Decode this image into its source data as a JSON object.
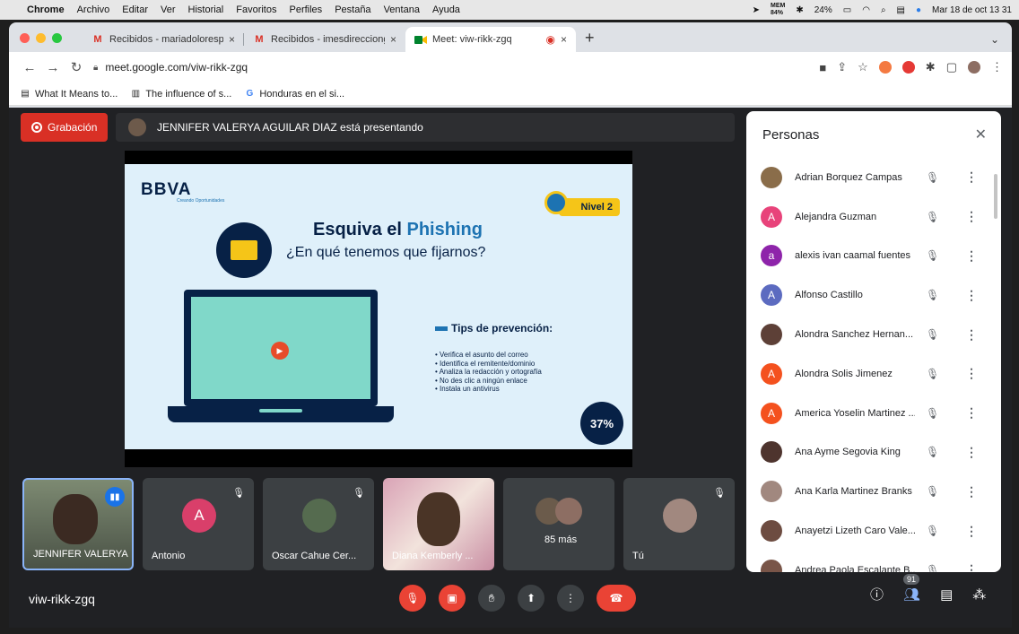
{
  "macos_menubar": {
    "app_name": "Chrome",
    "menus": [
      "Archivo",
      "Editar",
      "Ver",
      "Historial",
      "Favoritos",
      "Perfiles",
      "Pestaña",
      "Ventana",
      "Ayuda"
    ],
    "mem_label": "MEM",
    "mem_value": "84%",
    "battery": "24%",
    "datetime": "Mar 18 de oct 13 31"
  },
  "browser": {
    "tabs": [
      {
        "label": "Recibidos - mariadolorespanto",
        "favicon": "gmail-icon"
      },
      {
        "label": "Recibidos - imesdirecciongene",
        "favicon": "gmail-icon"
      },
      {
        "label": "Meet: viw-rikk-zgq",
        "favicon": "meet-icon",
        "active": true
      }
    ],
    "url": "meet.google.com/viw-rikk-zgq",
    "bookmarks": [
      "What It Means to...",
      "The influence of s...",
      "Honduras en el si..."
    ]
  },
  "meet": {
    "recording_label": "Grabación",
    "presenting_text": "JENNIFER VALERYA AGUILAR DIAZ está presentando",
    "meeting_code": "viw-rikk-zgq",
    "people_count": "91",
    "slide": {
      "brand": "BBVA",
      "tagline": "Creando Oportunidades",
      "level": "Nivel 2",
      "title_part1": "Esquiva el ",
      "title_part2": "Phishing",
      "subtitle": "¿En qué tenemos que fijarnos?",
      "tips_title": "Tips de prevención:",
      "tips": [
        "Verifica el asunto del correo",
        "Identifica el remitente/dominio",
        "Analiza la redacción y ortografía",
        "No des clic a ningún enlace",
        "Instala un antivirus"
      ],
      "progress": "37%"
    },
    "tiles": [
      {
        "name": "JENNIFER VALERYA",
        "speaking": true
      },
      {
        "name": "Antonio",
        "initial": "A",
        "color": "#d93f6a"
      },
      {
        "name": "Oscar Cahue Cer..."
      },
      {
        "name": "Diana Kemberly ..."
      },
      {
        "name": "85 más"
      },
      {
        "name": "Tú"
      }
    ],
    "panel": {
      "title": "Personas",
      "people": [
        {
          "name": "Adrian Borquez Campas",
          "initial": "",
          "color": "#8a6d4a"
        },
        {
          "name": "Alejandra Guzman",
          "initial": "A",
          "color": "#e8437a"
        },
        {
          "name": "alexis ivan caamal fuentes",
          "initial": "a",
          "color": "#8e24aa"
        },
        {
          "name": "Alfonso Castillo",
          "initial": "A",
          "color": "#5c6bc0"
        },
        {
          "name": "Alondra Sanchez Hernan...",
          "initial": "",
          "color": "#5d4037"
        },
        {
          "name": "Alondra Solis Jimenez",
          "initial": "A",
          "color": "#f4511e"
        },
        {
          "name": "America Yoselin Martinez ...",
          "initial": "A",
          "color": "#f4511e"
        },
        {
          "name": "Ana Ayme Segovia King",
          "initial": "",
          "color": "#4e342e"
        },
        {
          "name": "Ana Karla Martinez Branks",
          "initial": "",
          "color": "#a1887f"
        },
        {
          "name": "Anayetzi Lizeth Caro Vale...",
          "initial": "",
          "color": "#6d4c41"
        },
        {
          "name": "Andrea Paola Escalante B...",
          "initial": "",
          "color": "#795548"
        }
      ]
    }
  }
}
